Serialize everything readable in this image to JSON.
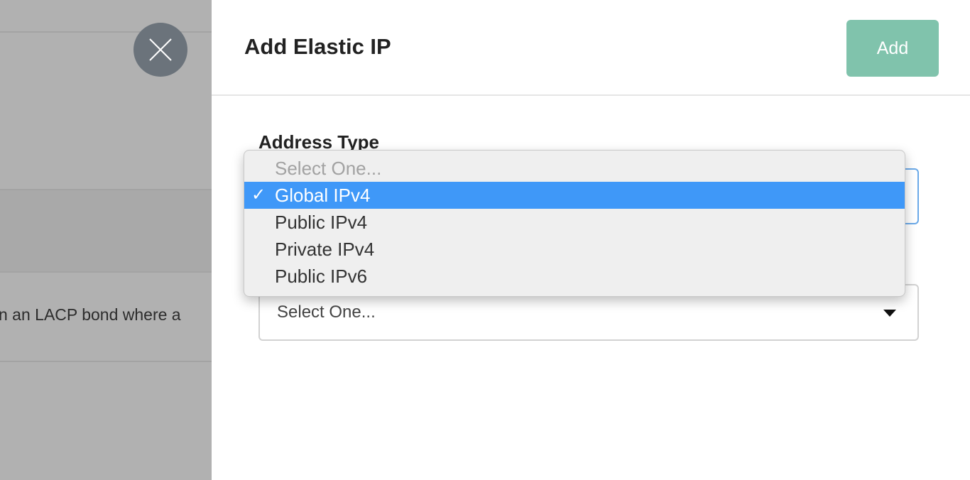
{
  "background": {
    "partial_text": "n an LACP bond where a"
  },
  "panel": {
    "title": "Add Elastic IP",
    "add_label": "Add",
    "address_type_label": "Address Type",
    "second_select_value": "Select One..."
  },
  "dropdown": {
    "options": [
      {
        "label": "Select One...",
        "placeholder": true
      },
      {
        "label": "Global IPv4",
        "selected": true
      },
      {
        "label": "Public IPv4"
      },
      {
        "label": "Private IPv4"
      },
      {
        "label": "Public IPv6"
      }
    ],
    "checkmark": "✓"
  },
  "colors": {
    "accent_add_button": "#80c3ac",
    "selected_option": "#3f98f8",
    "focus_border": "#6aa9e8"
  },
  "icons": {
    "close": "close-icon",
    "caret": "chevron-down-icon"
  }
}
